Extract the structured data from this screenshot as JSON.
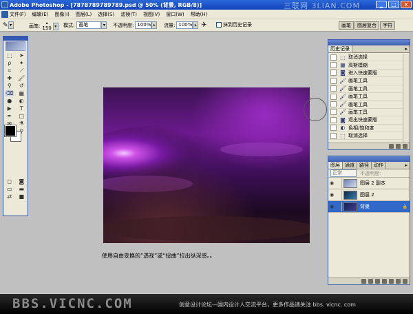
{
  "window": {
    "title": "Adobe Photoshop - [7878789789789.psd @ 50% (背景, RGB/8)]",
    "watermark": "三联网 3LIAN.COM"
  },
  "menu": [
    "文件(F)",
    "编辑(E)",
    "图像(I)",
    "图层(L)",
    "选择(S)",
    "滤镜(T)",
    "视图(V)",
    "窗口(W)",
    "帮助(H)"
  ],
  "options": {
    "brush_label": "画笔:",
    "brush_size": "150",
    "mode_label": "模式:",
    "mode_value": "画笔",
    "opacity_label": "不透明度:",
    "opacity_value": "100%",
    "flow_label": "流量:",
    "flow_value": "100%",
    "history_check_label": "抹到历史记录"
  },
  "dock_tabs": [
    "画笔",
    "图层复合",
    "字符"
  ],
  "history_panel": {
    "tab": "历史记录",
    "items": [
      {
        "label": "取消选择",
        "icon": "dashed-rect-icon"
      },
      {
        "label": "高斯模糊",
        "icon": "filter-icon"
      },
      {
        "label": "进入快速蒙版",
        "icon": "quickmask-icon"
      },
      {
        "label": "画笔工具",
        "icon": "brush-icon"
      },
      {
        "label": "画笔工具",
        "icon": "brush-icon"
      },
      {
        "label": "画笔工具",
        "icon": "brush-icon"
      },
      {
        "label": "画笔工具",
        "icon": "brush-icon"
      },
      {
        "label": "画笔工具",
        "icon": "brush-icon"
      },
      {
        "label": "退出快速蒙版",
        "icon": "quickmask-icon"
      },
      {
        "label": "色相/饱和度",
        "icon": "adjust-icon"
      },
      {
        "label": "取消选择",
        "icon": "dashed-rect-icon"
      }
    ]
  },
  "layers_panel": {
    "tabs": [
      "图层",
      "通道",
      "路径",
      "动作"
    ],
    "blend_mode": "正常",
    "opacity_label": "不透明度:",
    "layers": [
      {
        "name": "图层 2 副本",
        "selected": false
      },
      {
        "name": "图层 2",
        "selected": false
      },
      {
        "name": "背景",
        "selected": true
      }
    ]
  },
  "caption": "使用自由变换的”透视”或“扭曲”拉出纵深感。。",
  "footer": {
    "site": "BBS.VICNC.COM",
    "slogan": "创意设计论坛—国内设计人交流平台，更多作品请关注 bbs. vicnc. com"
  },
  "colors": {
    "title_bar": "#1f55c8",
    "panel_bg": "#ece9d8",
    "selected_layer": "#3269c9",
    "workspace": "#c0c0c0"
  }
}
